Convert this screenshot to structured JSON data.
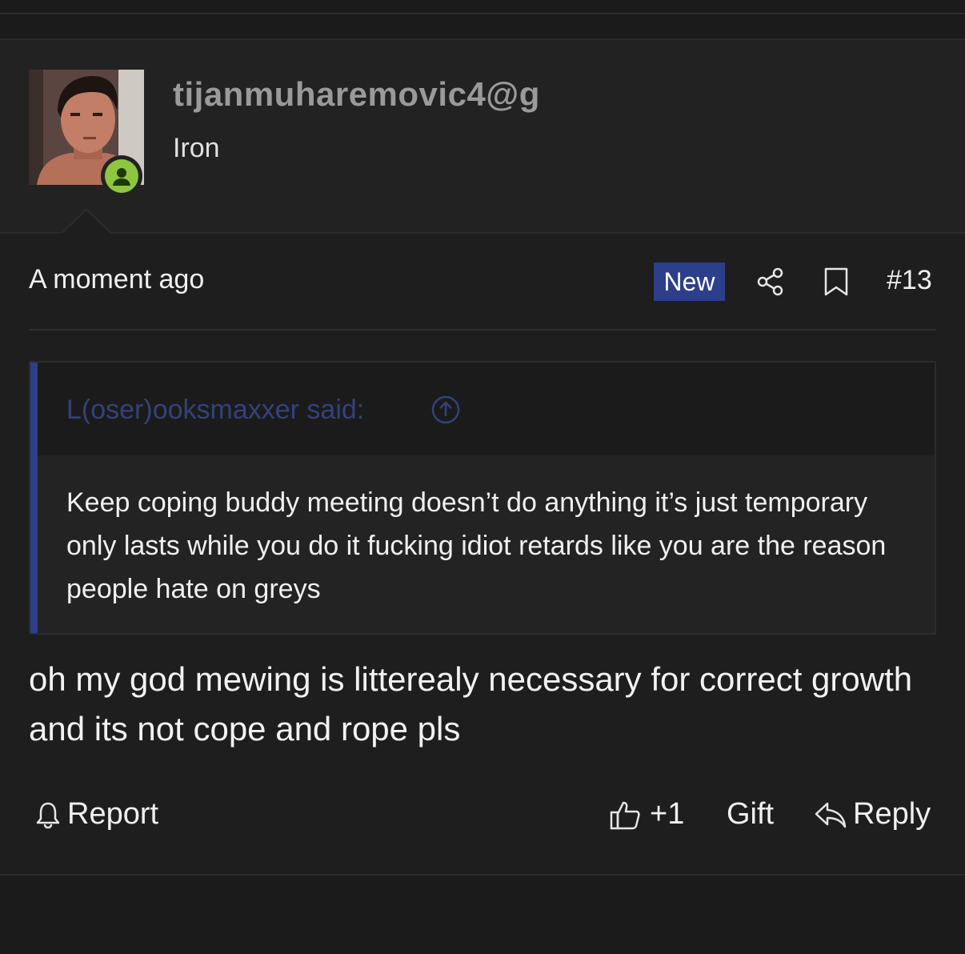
{
  "user": {
    "username": "tijanmuharemovic4@g",
    "title": "Iron",
    "online_status_icon": "user-online-icon",
    "online_color": "#8dc63f"
  },
  "post_meta": {
    "timestamp": "A moment ago",
    "new_badge": "New",
    "new_badge_color": "#2d3f8a",
    "share_icon": "share-icon",
    "bookmark_icon": "bookmark-icon",
    "post_number": "#13"
  },
  "quote": {
    "attribution": "L(oser)ooksmaxxer said:",
    "jump_icon": "arrow-up-circle-icon",
    "text": "Keep coping buddy meeting doesn’t do anything it’s just temporary only lasts while you do it fucking idiot retards like you are the reason people hate on greys"
  },
  "post": {
    "body": "oh my god mewing is litterealy necessary for correct growth and its not cope and rope pls"
  },
  "actions": {
    "report_label": "Report",
    "report_icon": "bell-icon",
    "like_label": "+1",
    "like_icon": "thumbs-up-icon",
    "gift_label": "Gift",
    "reply_label": "Reply",
    "reply_icon": "reply-icon"
  }
}
